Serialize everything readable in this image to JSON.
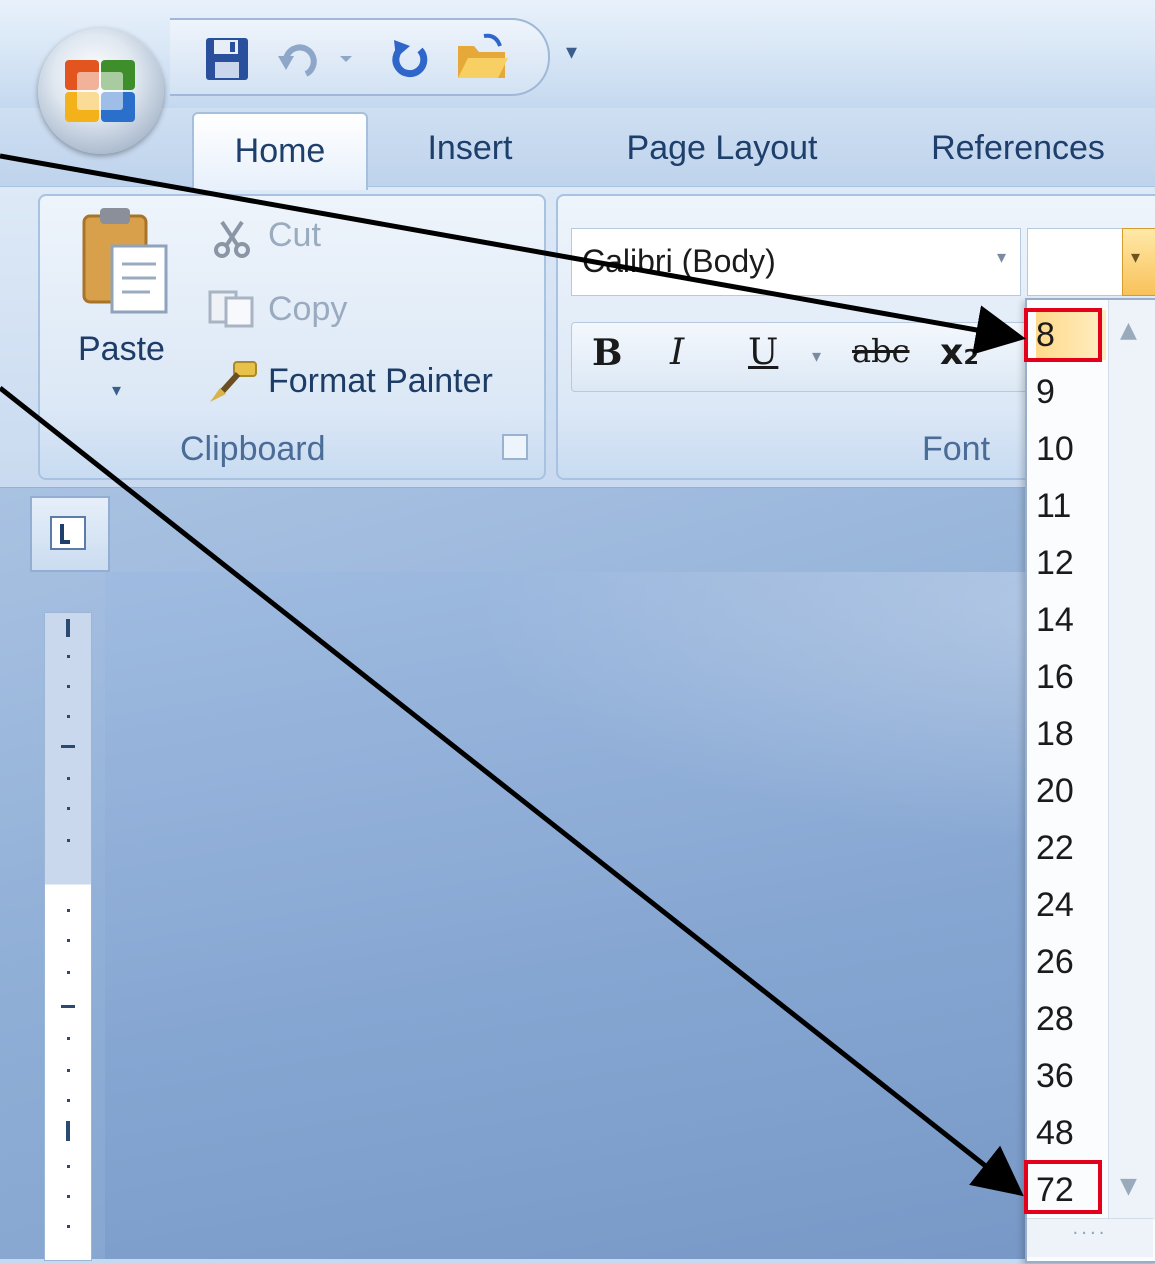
{
  "quick_access": {
    "items": [
      "save-icon",
      "undo-icon",
      "redo-icon",
      "open-folder-icon"
    ],
    "more_glyph": "▾"
  },
  "tabs": [
    {
      "label": "Home",
      "active": true
    },
    {
      "label": "Insert",
      "active": false
    },
    {
      "label": "Page Layout",
      "active": false
    },
    {
      "label": "References",
      "active": false
    }
  ],
  "clipboard": {
    "paste_label": "Paste",
    "cut_label": "Cut",
    "copy_label": "Copy",
    "format_painter_label": "Format Painter",
    "group_label": "Clipboard"
  },
  "font_group": {
    "font_name": "Calibri (Body)",
    "font_size_value": "",
    "group_label": "Font",
    "bold": "B",
    "italic": "I",
    "underline": "U",
    "strikethrough": "abc",
    "subscript": "x₂"
  },
  "font_size_list": {
    "sizes": [
      "8",
      "9",
      "10",
      "11",
      "12",
      "14",
      "16",
      "18",
      "20",
      "22",
      "24",
      "26",
      "28",
      "36",
      "48",
      "72"
    ],
    "selected": "8",
    "highlighted": [
      "8",
      "72"
    ]
  },
  "colors": {
    "accent_highlight": "#e3001b",
    "selection": "#ffd98a",
    "ribbon_text": "#1e3f6b"
  }
}
